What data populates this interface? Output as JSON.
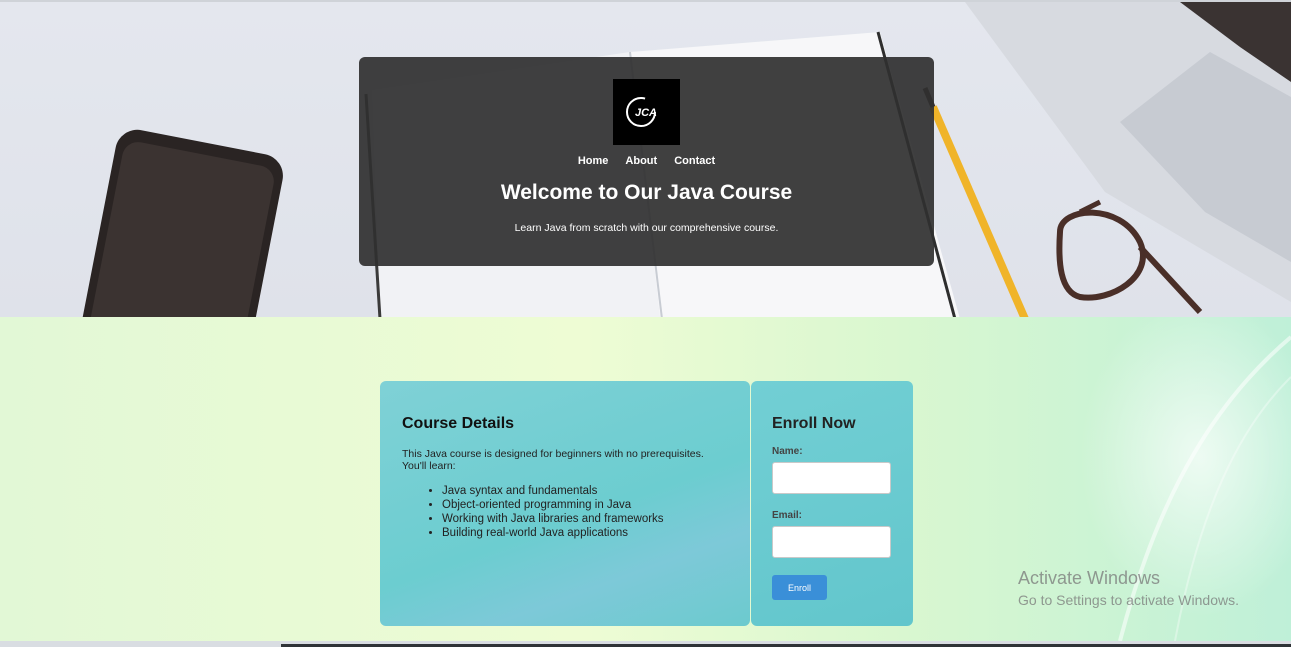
{
  "logo": {
    "text": "JCA"
  },
  "nav": {
    "items": [
      "Home",
      "About",
      "Contact"
    ]
  },
  "hero": {
    "title": "Welcome to Our Java Course",
    "subtitle": "Learn Java from scratch with our comprehensive course."
  },
  "details": {
    "title": "Course Details",
    "intro": "This Java course is designed for beginners with no prerequisites. You'll learn:",
    "items": [
      "Java syntax and fundamentals",
      "Object-oriented programming in Java",
      "Working with Java libraries and frameworks",
      "Building real-world Java applications"
    ]
  },
  "enroll": {
    "title": "Enroll Now",
    "name_label": "Name:",
    "email_label": "Email:",
    "button_label": "Enroll"
  },
  "watermark": {
    "title": "Activate Windows",
    "subtitle": "Go to Settings to activate Windows."
  },
  "colors": {
    "card_overlay": "#303030",
    "button": "#3a8fd8",
    "panel_teal": "#6ccdd0"
  }
}
